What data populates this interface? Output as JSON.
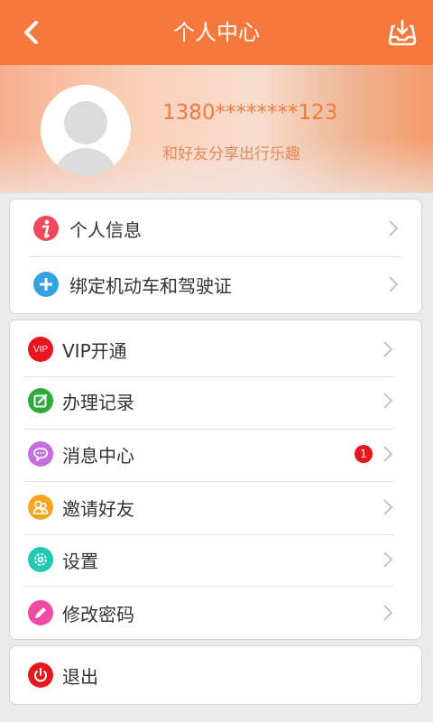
{
  "header": {
    "title": "个人中心",
    "back_icon": "back-arrow-icon",
    "download_icon": "download-tray-icon"
  },
  "profile": {
    "phone": "1380********123",
    "slogan": "和好友分享出行乐趣"
  },
  "group1": [
    {
      "label": "个人信息",
      "icon": "info-icon",
      "color": "#ee4a5a"
    },
    {
      "label": "绑定机动车和驾驶证",
      "icon": "plus-icon",
      "color": "#36a2e3"
    }
  ],
  "group2": [
    {
      "label": "VIP开通",
      "icon": "vip-icon",
      "color": "#e8161f",
      "icon_text": "VIP"
    },
    {
      "label": "办理记录",
      "icon": "edit-note-icon",
      "color": "#2eab3c"
    },
    {
      "label": "消息中心",
      "icon": "chat-bubble-icon",
      "color": "#c66ee0",
      "badge": "1"
    },
    {
      "label": "邀请好友",
      "icon": "friends-icon",
      "color": "#f5a623"
    },
    {
      "label": "设置",
      "icon": "gear-icon",
      "color": "#20c9b3"
    },
    {
      "label": "修改密码",
      "icon": "pencil-icon",
      "color": "#f04aa6"
    }
  ],
  "group3": [
    {
      "label": "退出",
      "icon": "power-icon",
      "color": "#e8161f"
    }
  ],
  "colors": {
    "accent": "#f7783c",
    "badge": "#e8161f"
  }
}
